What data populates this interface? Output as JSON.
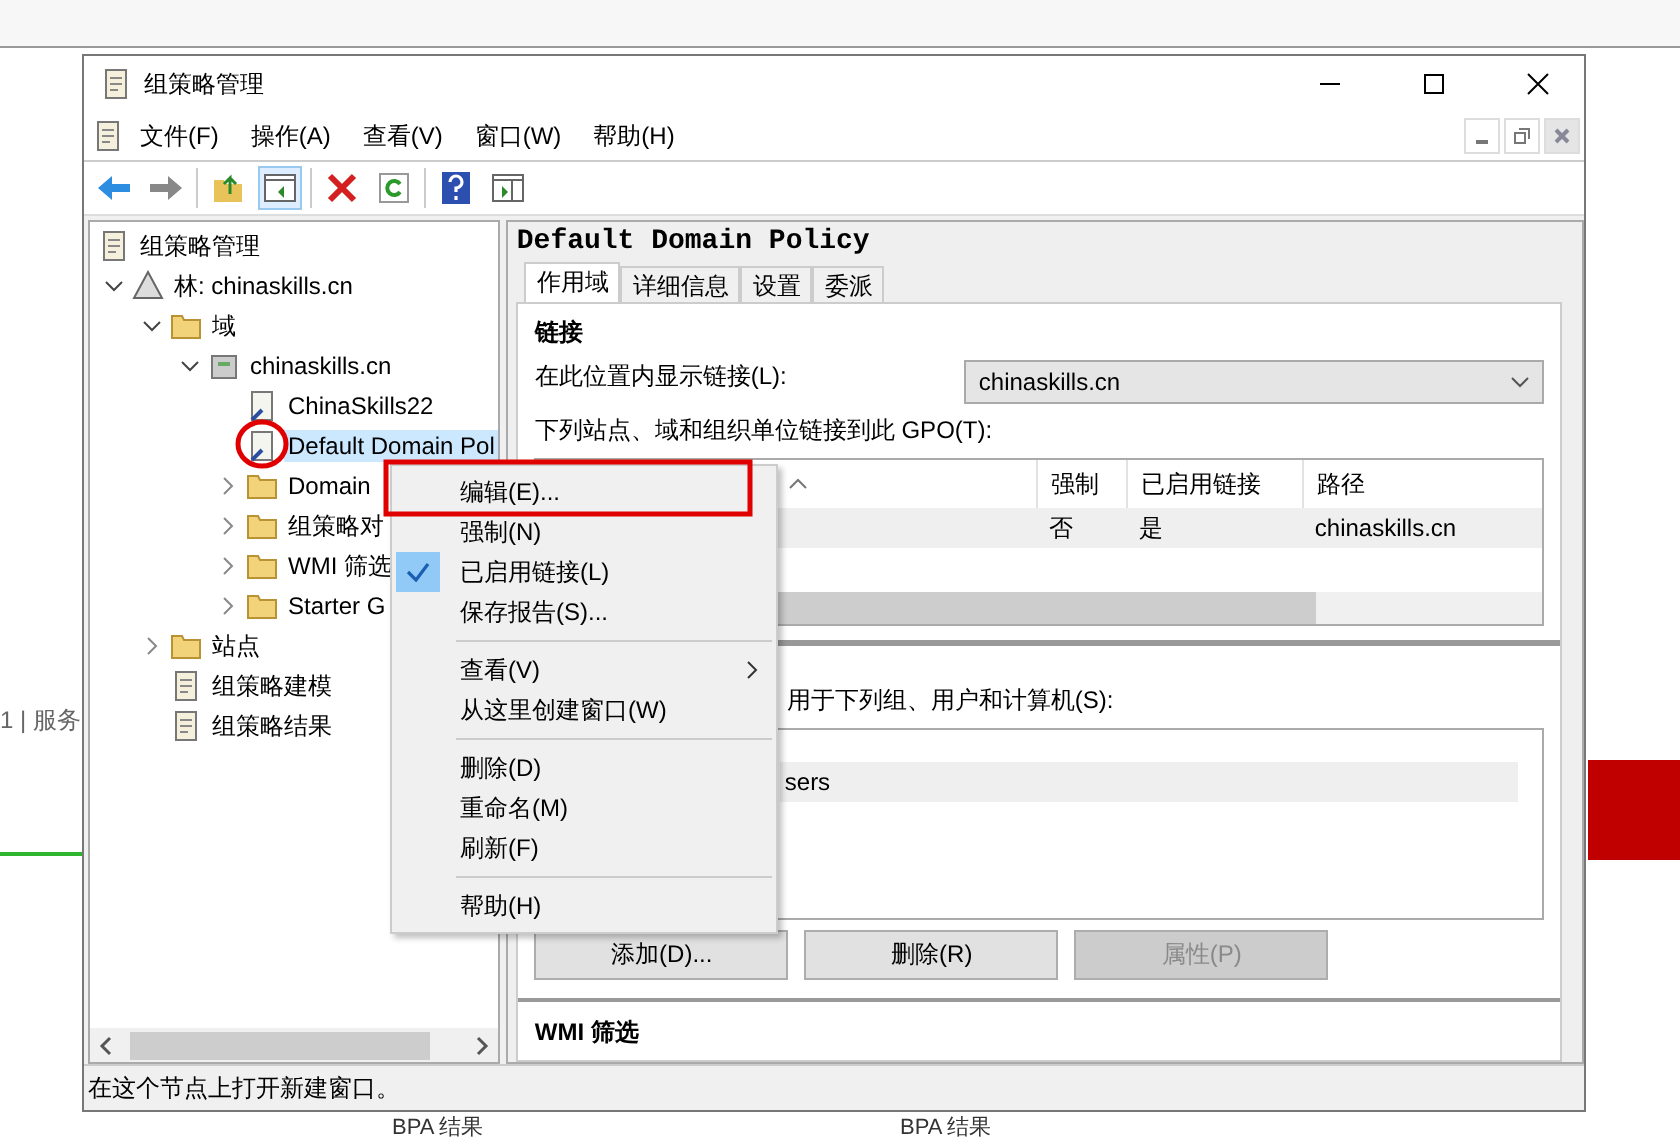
{
  "desktop": {
    "side_text": "1 | 服务",
    "results": [
      "BPA 结果",
      "BPA 结果"
    ]
  },
  "window": {
    "title": "组策略管理"
  },
  "menu_bar": [
    "文件(F)",
    "操作(A)",
    "查看(V)",
    "窗口(W)",
    "帮助(H)"
  ],
  "tree": {
    "root": "组策略管理",
    "items": [
      {
        "label": "林: chinaskills.cn",
        "kind": "forest",
        "expanded": true,
        "selected": false,
        "children": [
          {
            "label": "域",
            "kind": "folder",
            "expanded": true,
            "selected": false,
            "children": [
              {
                "label": "chinaskills.cn",
                "kind": "domain",
                "expanded": true,
                "selected": false,
                "children": [
                  {
                    "label": "ChinaSkills22",
                    "kind": "link",
                    "selected": false
                  },
                  {
                    "label": "Default Domain Pol",
                    "kind": "link",
                    "selected": true
                  },
                  {
                    "label": "Domain",
                    "kind": "folder",
                    "expanded": false,
                    "selected": false
                  },
                  {
                    "label": "组策略对",
                    "kind": "folder",
                    "expanded": false,
                    "selected": false
                  },
                  {
                    "label": "WMI 筛选",
                    "kind": "folder",
                    "expanded": false,
                    "selected": false
                  },
                  {
                    "label": "Starter G",
                    "kind": "folder",
                    "expanded": false,
                    "selected": false
                  }
                ]
              }
            ]
          },
          {
            "label": "站点",
            "kind": "folder",
            "expanded": false,
            "selected": false
          },
          {
            "label": "组策略建模",
            "kind": "scroll",
            "selected": false
          },
          {
            "label": "组策略结果",
            "kind": "scroll",
            "selected": false
          }
        ]
      }
    ]
  },
  "details": {
    "title": "Default Domain Policy",
    "tabs": [
      {
        "label": "作用域",
        "selected": true
      },
      {
        "label": "详细信息",
        "selected": false
      },
      {
        "label": "设置",
        "selected": false
      },
      {
        "label": "委派",
        "selected": false
      }
    ],
    "links_heading": "链接",
    "location_label": "在此位置内显示链接(L):",
    "location_value": "chinaskills.cn",
    "links_label": "下列站点、域和组织单位链接到此 GPO(T):",
    "links_table": {
      "columns": [
        "强制",
        "已启用链接",
        "路径"
      ],
      "rows": [
        {
          "cells": [
            "否",
            "是",
            "chinaskills.cn"
          ],
          "selected": true
        }
      ]
    },
    "filter_label": "用于下列组、用户和计算机(S):",
    "filter_list": [
      "sers"
    ],
    "buttons": [
      {
        "label": "添加(D)...",
        "disabled": false
      },
      {
        "label": "删除(R)",
        "disabled": false
      },
      {
        "label": "属性(P)",
        "disabled": true
      }
    ],
    "wmi_heading": "WMI 筛选"
  },
  "context_menu": {
    "items": [
      {
        "kind": "item",
        "label": "编辑(E)...",
        "checked": false
      },
      {
        "kind": "item",
        "label": "强制(N)",
        "checked": false
      },
      {
        "kind": "item",
        "label": "已启用链接(L)",
        "checked": true
      },
      {
        "kind": "item",
        "label": "保存报告(S)...",
        "checked": false
      },
      {
        "kind": "separator"
      },
      {
        "kind": "submenu",
        "label": "查看(V)",
        "checked": false
      },
      {
        "kind": "item",
        "label": "从这里创建窗口(W)",
        "checked": false
      },
      {
        "kind": "separator"
      },
      {
        "kind": "item",
        "label": "删除(D)",
        "checked": false
      },
      {
        "kind": "item",
        "label": "重命名(M)",
        "checked": false
      },
      {
        "kind": "item",
        "label": "刷新(F)",
        "checked": false
      },
      {
        "kind": "separator"
      },
      {
        "kind": "item",
        "label": "帮助(H)",
        "checked": false
      }
    ]
  },
  "status_bar": "在这个节点上打开新建窗口。"
}
